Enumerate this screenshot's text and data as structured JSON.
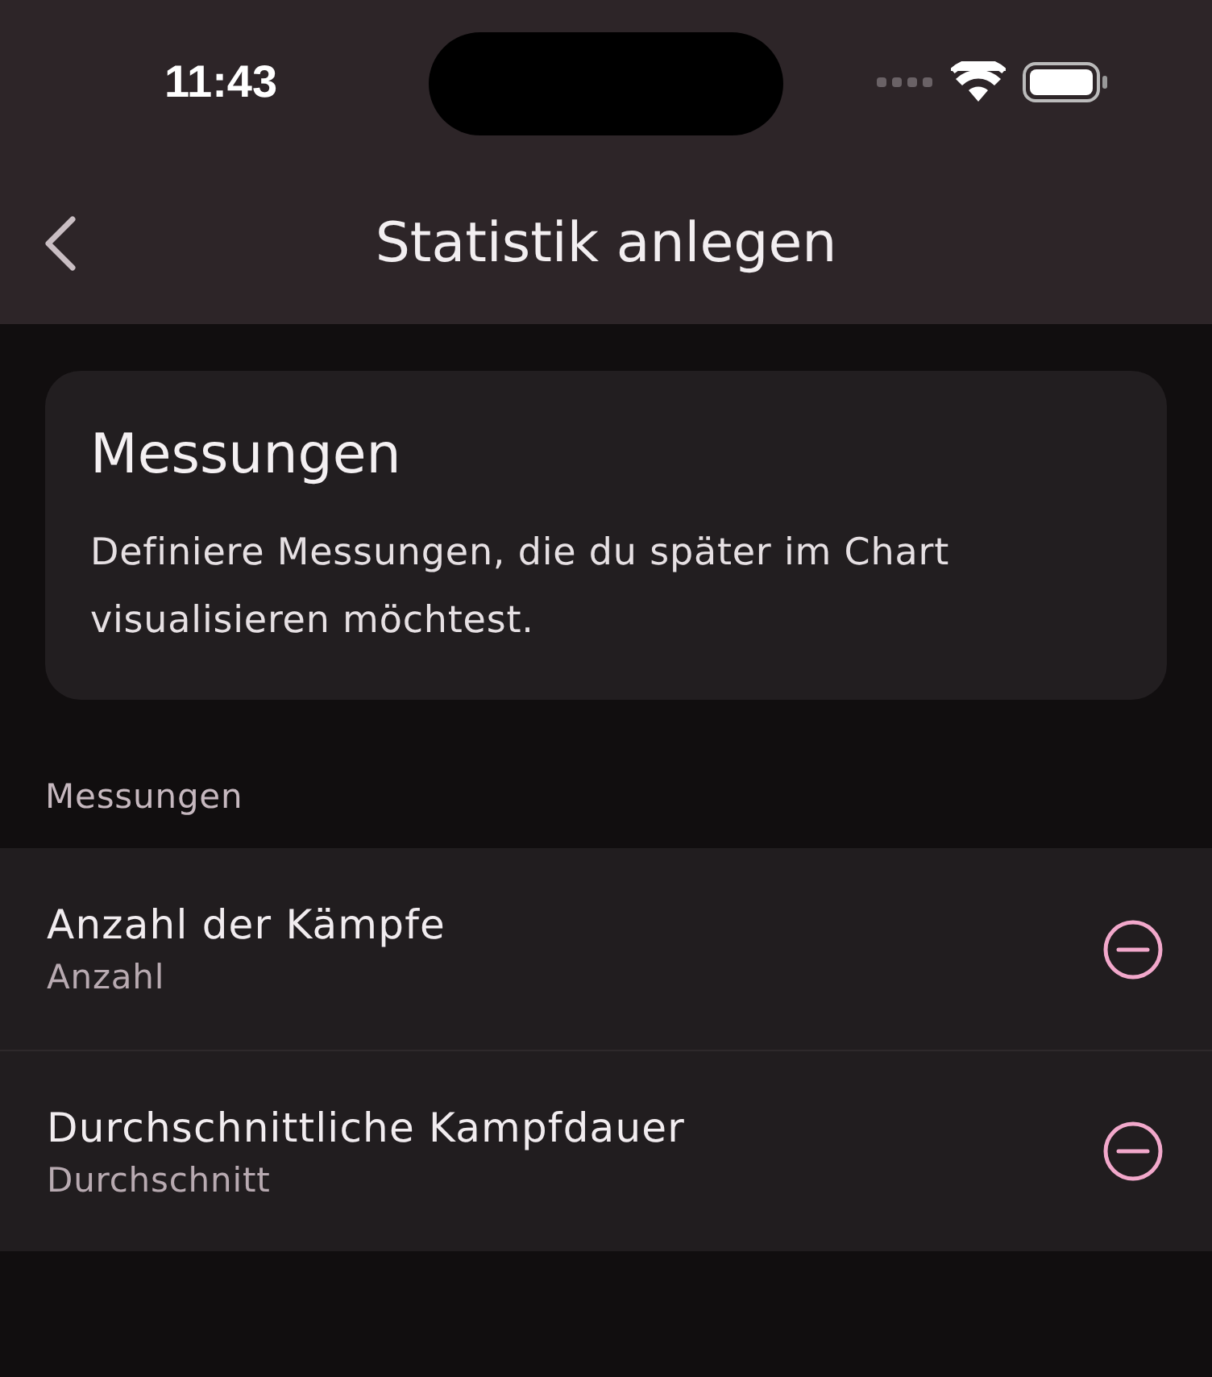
{
  "status_bar": {
    "time": "11:43"
  },
  "nav": {
    "title": "Statistik anlegen"
  },
  "info_card": {
    "title": "Messungen",
    "text": "Definiere Messungen, die du später im Chart visualisieren möchtest."
  },
  "section_label": "Messungen",
  "measurements": [
    {
      "title": "Anzahl der Kämpfe",
      "subtitle": "Anzahl"
    },
    {
      "title": "Durchschnittliche Kampfdauer",
      "subtitle": "Durchschnitt"
    }
  ]
}
